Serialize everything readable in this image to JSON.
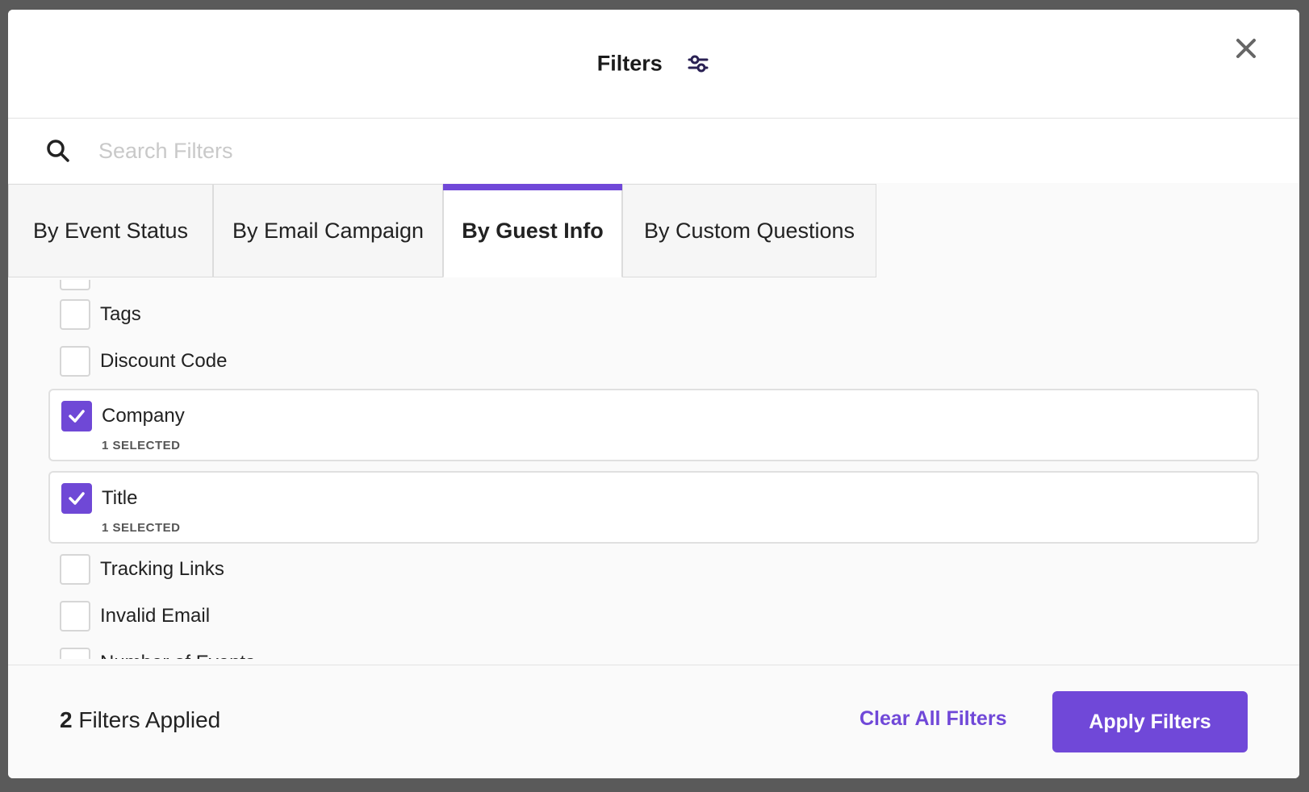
{
  "modal": {
    "title": "Filters",
    "close_icon": "close-icon",
    "filters_icon": "sliders-icon"
  },
  "search": {
    "placeholder": "Search Filters",
    "value": ""
  },
  "tabs": [
    {
      "label": "By Event Status",
      "active": false
    },
    {
      "label": "By Email Campaign",
      "active": false
    },
    {
      "label": "By Guest Info",
      "active": true
    },
    {
      "label": "By Custom Questions",
      "active": false
    }
  ],
  "filter_items": [
    {
      "label": "Tags",
      "checked": false
    },
    {
      "label": "Discount Code",
      "checked": false
    },
    {
      "label": "Company",
      "checked": true,
      "sub": "1 SELECTED"
    },
    {
      "label": "Title",
      "checked": true,
      "sub": "1 SELECTED"
    },
    {
      "label": "Tracking Links",
      "checked": false
    },
    {
      "label": "Invalid Email",
      "checked": false
    },
    {
      "label": "Number of Events",
      "checked": false
    }
  ],
  "footer": {
    "applied_count": "2",
    "applied_label": "Filters Applied",
    "clear_label": "Clear All Filters",
    "apply_label": "Apply Filters"
  },
  "colors": {
    "accent": "#7048d8",
    "overlay": "#5a5a5a"
  }
}
